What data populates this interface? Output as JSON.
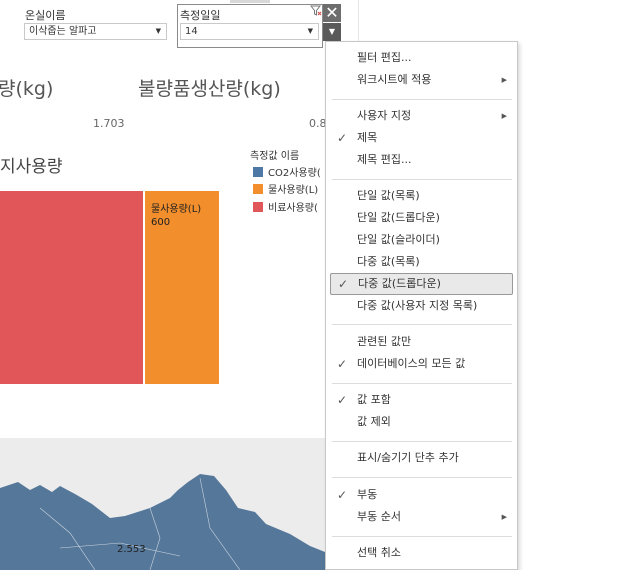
{
  "filters": {
    "greenhouse": {
      "label": "온실이름",
      "value": "이삭줍는 알파고"
    },
    "date": {
      "label": "측정일일",
      "value": "14"
    },
    "close_glyph": "✕",
    "menu_glyph": "▼",
    "dropdown_glyph": "▼"
  },
  "kpis": {
    "left_title": "량(kg)",
    "right_title": "불량품생산량(kg)",
    "left_value": "1.703",
    "right_value": "0.8"
  },
  "chart_data": {
    "type": "bar",
    "title": "지사용량",
    "categories": [
      "비료사용량",
      "물사용량(L)"
    ],
    "values": [
      null,
      600
    ],
    "value_labels": [
      "",
      "600"
    ],
    "category_label": "물사용량(L)",
    "colors": {
      "CO2사용량": "#4e79a7",
      "물사용량(L)": "#f28e2b",
      "비료사용량": "#e15759"
    },
    "legend": {
      "title": "측정값 이름",
      "placement": "right",
      "items": [
        {
          "name": "CO2사용량(",
          "color": "#4e79a7"
        },
        {
          "name": "물사용량(L)",
          "color": "#f28e2b"
        },
        {
          "name": "비료사용량(",
          "color": "#e15759"
        }
      ]
    }
  },
  "map": {
    "value": "2.553",
    "land_color": "#55779a"
  },
  "context_menu": {
    "items": [
      {
        "label": "필터 편집...",
        "check": "",
        "sub": ""
      },
      {
        "label": "워크시트에 적용",
        "check": "",
        "sub": "▶"
      },
      {
        "label": "사용자 지정",
        "check": "",
        "sub": "▶"
      },
      {
        "label": "제목",
        "check": "✓",
        "sub": ""
      },
      {
        "label": "제목 편집...",
        "check": "",
        "sub": ""
      },
      {
        "label": "단일 값(목록)",
        "check": "",
        "sub": ""
      },
      {
        "label": "단일 값(드롭다운)",
        "check": "",
        "sub": ""
      },
      {
        "label": "단일 값(슬라이더)",
        "check": "",
        "sub": ""
      },
      {
        "label": "다중 값(목록)",
        "check": "",
        "sub": ""
      },
      {
        "label": "다중 값(드롭다운)",
        "check": "✓",
        "sub": "",
        "highlighted": true
      },
      {
        "label": "다중 값(사용자 지정 목록)",
        "check": "",
        "sub": ""
      },
      {
        "label": "관련된 값만",
        "check": "",
        "sub": ""
      },
      {
        "label": "데이터베이스의 모든 값",
        "check": "✓",
        "sub": ""
      },
      {
        "label": "값 포함",
        "check": "✓",
        "sub": ""
      },
      {
        "label": "값 제외",
        "check": "",
        "sub": ""
      },
      {
        "label": "표시/숨기기 단추 추가",
        "check": "",
        "sub": ""
      },
      {
        "label": "부동",
        "check": "✓",
        "sub": ""
      },
      {
        "label": "부동 순서",
        "check": "",
        "sub": "▶"
      },
      {
        "label": "선택 취소",
        "check": "",
        "sub": ""
      }
    ]
  }
}
